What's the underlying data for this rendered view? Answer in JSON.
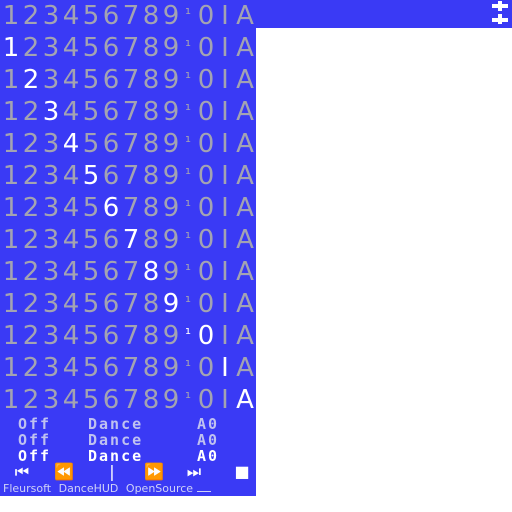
{
  "colors": {
    "background": "#3a3af5",
    "inactive_digit": "#a3a3b2",
    "active_digit": "#ffffff",
    "status_on": "#ffffff",
    "status_dim": "#bfc1f0"
  },
  "columns": [
    "1",
    "2",
    "3",
    "4",
    "5",
    "6",
    "7",
    "8",
    "9",
    "¹",
    "0",
    "I",
    "A"
  ],
  "rows": [
    {
      "active": -1
    },
    {
      "active": 0
    },
    {
      "active": 1
    },
    {
      "active": 2
    },
    {
      "active": 3
    },
    {
      "active": 4
    },
    {
      "active": 5
    },
    {
      "active": 6
    },
    {
      "active": 7
    },
    {
      "active": 8
    },
    {
      "active": 9
    },
    {
      "active": 11
    },
    {
      "active": 12
    }
  ],
  "status_rows": [
    {
      "mode": "Off",
      "action": "Dance",
      "code": "A0",
      "highlight": false
    },
    {
      "mode": "Off",
      "action": "Dance",
      "code": "A0",
      "highlight": false
    },
    {
      "mode": "Off",
      "action": "Dance",
      "code": "A0",
      "highlight": true
    }
  ],
  "controls": [
    {
      "name": "skip-to-start-icon",
      "glyph": "⏮"
    },
    {
      "name": "rewind-icon",
      "glyph": "⏪"
    },
    {
      "name": "pause-icon",
      "glyph": "|"
    },
    {
      "name": "fast-forward-icon",
      "glyph": "⏩"
    },
    {
      "name": "skip-to-end-icon",
      "glyph": "⏭"
    },
    {
      "name": "stop-icon",
      "glyph": "■"
    }
  ],
  "footer": {
    "brand": "Fleursoft",
    "product": "DanceHUD",
    "license": "OpenSource"
  }
}
